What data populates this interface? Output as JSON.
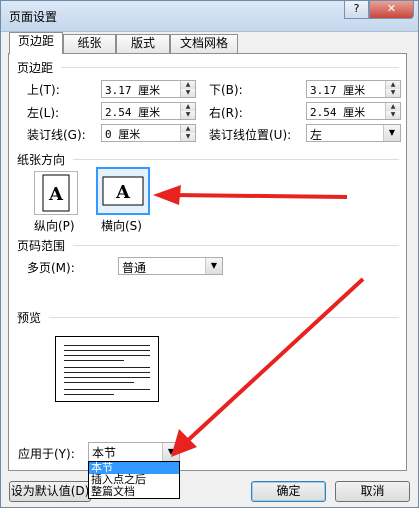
{
  "window": {
    "title": "页面设置",
    "help_label": "?",
    "close_label": "✕"
  },
  "tabs": [
    {
      "label": "页边距",
      "active": true
    },
    {
      "label": "纸张",
      "active": false
    },
    {
      "label": "版式",
      "active": false
    },
    {
      "label": "文档网格",
      "active": false
    }
  ],
  "margins": {
    "section_title": "页边距",
    "top_label": "上(T):",
    "top_value": "3.17 厘米",
    "bottom_label": "下(B):",
    "bottom_value": "3.17 厘米",
    "left_label": "左(L):",
    "left_value": "2.54 厘米",
    "right_label": "右(R):",
    "right_value": "2.54 厘米",
    "gutter_label": "装订线(G):",
    "gutter_value": "0 厘米",
    "gutter_pos_label": "装订线位置(U):",
    "gutter_pos_value": "左"
  },
  "orientation": {
    "section_title": "纸张方向",
    "portrait_label": "纵向(P)",
    "landscape_label": "横向(S)",
    "selected": "landscape",
    "glyph": "A"
  },
  "pages": {
    "section_title": "页码范围",
    "multiple_label": "多页(M):",
    "multiple_value": "普通"
  },
  "preview": {
    "section_title": "预览"
  },
  "apply": {
    "label": "应用于(Y):",
    "value": "本节",
    "options": [
      "本节",
      "插入点之后",
      "整篇文档"
    ],
    "selected_index": 0
  },
  "buttons": {
    "set_default": "设为默认值(D)",
    "ok": "确定",
    "cancel": "取消"
  },
  "icons": {
    "spin_up": "▲",
    "spin_down": "▼",
    "dropdown": "▼"
  },
  "colors": {
    "annotation_arrow": "#e8231f",
    "selection": "#3399ff"
  }
}
